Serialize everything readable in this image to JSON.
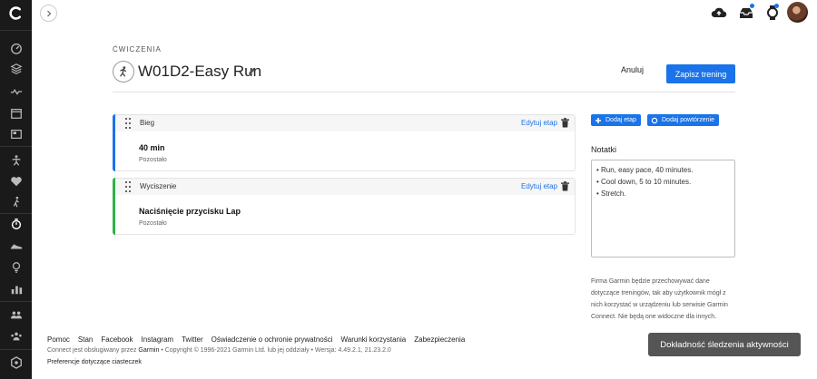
{
  "header": {
    "category": "ĆWICZENIA",
    "title": "W01D2-Easy Run",
    "cancel_label": "Anuluj",
    "save_label": "Zapisz trening"
  },
  "steps": [
    {
      "type": "Bieg",
      "edit_label": "Edytuj etap",
      "main": "40 min",
      "sub": "Pozostało",
      "color": "#1a73e8"
    },
    {
      "type": "Wyciszenie",
      "edit_label": "Edytuj etap",
      "main": "Naciśnięcie przycisku Lap",
      "sub": "Pozostało",
      "color": "#2db24a"
    }
  ],
  "actions": {
    "add_step": "Dodaj etap",
    "add_repeat": "Dodaj powtórzenie"
  },
  "notes": {
    "label": "Notatki",
    "lines": [
      "• Run, easy pace, 40 minutes.",
      "• Cool down, 5 to 10 minutes.",
      "• Stretch."
    ]
  },
  "privacy_text": "Firma Garmin będzie przechowywać dane dotyczące treningów, tak aby użytkownik mógł z nich korzystać w urządzeniu lub serwisie Garmin Connect. Nie będą one widoczne dla innych.",
  "footer": {
    "links": [
      "Pomoc",
      "Stan",
      "Facebook",
      "Instagram",
      "Twitter",
      "Oświadczenie o ochronie prywatności",
      "Warunki korzystania",
      "Zabezpieczenia"
    ],
    "copy_prefix": "Connect jest obsługiwany przez",
    "copy_brand": "Garmin",
    "copy_suffix": "• Copyright © 1996-2021 Garmin Ltd. lub jej oddziały • Wersja: 4.49.2.1, 21.23.2.0",
    "preferences": "Preferencje dotyczące ciasteczek"
  },
  "toast": "Dokładność śledzenia aktywności",
  "colors": {
    "accent": "#1a73e8",
    "sidebar": "#1a1a1a",
    "cooldown": "#2db24a"
  },
  "icons": {
    "sidebar": [
      "dashboard-icon",
      "layers-icon",
      "activity-wave-icon",
      "calendar-icon",
      "news-icon",
      "running-figure-icon",
      "heart-icon",
      "walking-icon",
      "stopwatch-icon",
      "shoe-icon",
      "lightbulb-icon",
      "bar-chart-icon",
      "groups-icon",
      "community-icon",
      "settings-icon"
    ],
    "top": [
      "cloud-sync-icon",
      "inbox-icon",
      "watch-icon"
    ]
  }
}
